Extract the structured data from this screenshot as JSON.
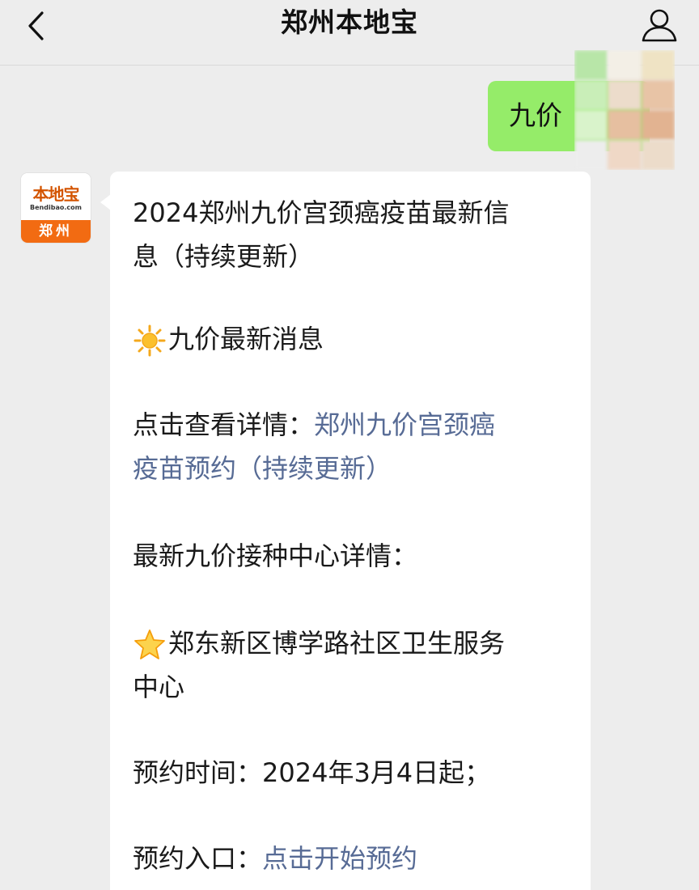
{
  "header": {
    "title": "郑州本地宝"
  },
  "sent_message": {
    "text": "九价"
  },
  "avatar": {
    "name": "本地宝",
    "domain": "Bendibao.com",
    "city": "郑州"
  },
  "message": {
    "line1": "2024郑州九价宫颈癌疫苗最新信",
    "line2": "息（持续更新）",
    "news_heading": "九价最新消息",
    "detail_prefix": "点击查看详情：",
    "detail_link_line1": "郑州九价宫颈癌",
    "detail_link_line2": "疫苗预约（持续更新）",
    "center_heading": "最新九价接种中心详情：",
    "center_name_line1": "郑东新区博学路社区卫生服务",
    "center_name_line2": "中心",
    "booking_time": "预约时间：2024年3月4日起；",
    "booking_entry_prefix": "预约入口：",
    "booking_entry_link": "点击开始预约"
  },
  "icons": {
    "back": "chevron-left-icon",
    "profile": "person-icon",
    "sun": "sun-emoji-icon",
    "star": "star-emoji-icon"
  },
  "colors": {
    "background": "#ededed",
    "sent_bubble": "#95ec69",
    "link": "#576b95",
    "avatar_orange": "#f26b12"
  }
}
